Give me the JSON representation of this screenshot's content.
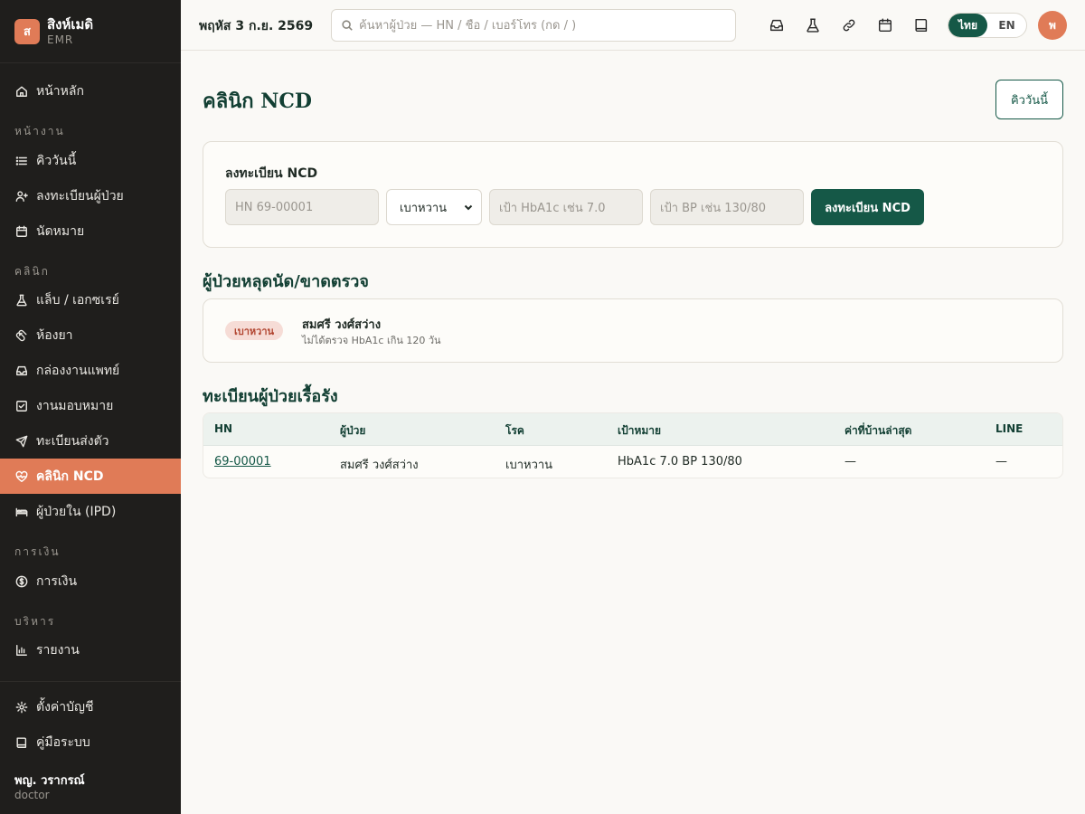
{
  "brand": {
    "logo_letter": "ส",
    "name": "สิงห์เมดิ",
    "sub": "EMR"
  },
  "sidebar": {
    "home": "หน้าหลัก",
    "sections": [
      "หน้างาน",
      "คลินิก",
      "การเงิน",
      "บริหาร"
    ],
    "work": [
      "คิววันนี้",
      "ลงทะเบียนผู้ป่วย",
      "นัดหมาย"
    ],
    "clinic": [
      "แล็บ / เอกซเรย์",
      "ห้องยา",
      "กล่องงานแพทย์",
      "งานมอบหมาย",
      "ทะเบียนส่งตัว",
      "คลินิก NCD",
      "ผู้ป่วยใน (IPD)"
    ],
    "finance": [
      "การเงิน"
    ],
    "admin": [
      "รายงาน"
    ],
    "bottom": [
      "ตั้งค่าบัญชี",
      "คู่มือระบบ"
    ],
    "user_name": "พญ. วรากรณ์",
    "user_role": "doctor"
  },
  "topbar": {
    "date": "พฤหัส 3 ก.ย. 2569",
    "search_placeholder": "ค้นหาผู้ป่วย — HN / ชื่อ / เบอร์โทร (กด / )",
    "lang_th": "ไทย",
    "lang_en": "EN",
    "avatar_letter": "พ",
    "icons": [
      "inbox-icon",
      "flask-icon",
      "link-icon",
      "calendar-icon",
      "book-icon"
    ]
  },
  "page": {
    "title": "คลินิก NCD",
    "queue_button": "คิววันนี้"
  },
  "register": {
    "title": "ลงทะเบียน NCD",
    "hn_placeholder": "HN 69-00001",
    "disease_selected": "เบาหวาน",
    "hba1c_placeholder": "เป้า HbA1c เช่น 7.0",
    "bp_placeholder": "เป้า BP เช่น 130/80",
    "submit": "ลงทะเบียน NCD"
  },
  "missed": {
    "title": "ผู้ป่วยหลุดนัด/ขาดตรวจ",
    "items": [
      {
        "badge": "เบาหวาน",
        "name": "สมศรี วงศ์สว่าง",
        "note": "ไม่ได้ตรวจ HbA1c เกิน 120 วัน"
      }
    ]
  },
  "registry": {
    "title": "ทะเบียนผู้ป่วยเรื้อรัง",
    "headers": [
      "HN",
      "ผู้ป่วย",
      "โรค",
      "เป้าหมาย",
      "ค่าที่บ้านล่าสุด",
      "LINE"
    ],
    "rows": [
      [
        "69-00001",
        "สมศรี วงศ์สว่าง",
        "เบาหวาน",
        "HbA1c 7.0 BP 130/80",
        "—",
        "—"
      ]
    ]
  },
  "colors": {
    "accent": "#e07b57",
    "primary": "#155847",
    "sidebar": "#1f1e1c"
  }
}
